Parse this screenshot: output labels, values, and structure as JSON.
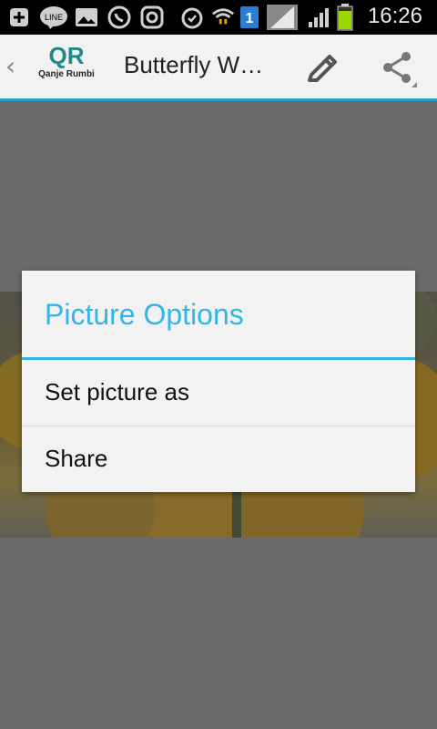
{
  "status_bar": {
    "time": "16:26",
    "icons": [
      "add-icon",
      "line-icon",
      "gallery-icon",
      "whatsapp-icon",
      "instagram-icon",
      "alarm-icon",
      "wifi-icon",
      "sim-1-icon",
      "signal-icon",
      "signal-icon",
      "battery-icon"
    ],
    "line_label": "LINE",
    "sim_label": "1"
  },
  "action_bar": {
    "logo_mark": "QR",
    "logo_name": "Qanje Rumbi",
    "title": "Butterfly W…"
  },
  "dialog": {
    "title": "Picture Options",
    "options": [
      {
        "label": "Set picture as"
      },
      {
        "label": "Share"
      }
    ]
  },
  "colors": {
    "accent": "#33b5e5",
    "action_bar_underline": "#2a9fc8",
    "dim_background": "#6a6a6a"
  }
}
